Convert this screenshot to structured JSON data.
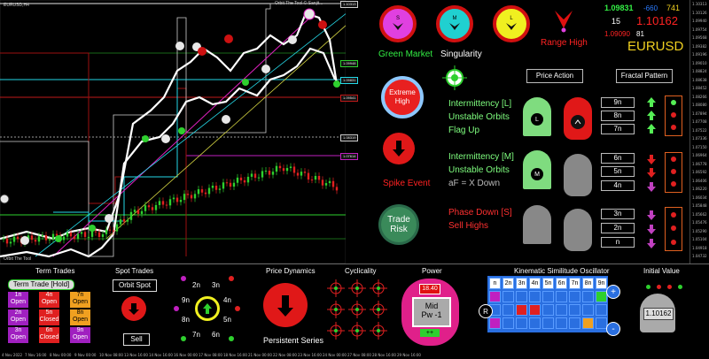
{
  "chart": {
    "symbol_header": "EURUSD,H4",
    "indicator_name": "Orbit The Tool",
    "footer_name": "Orbit The Tool © Sanjit...",
    "price_labels": [
      "1.10313",
      "1.10126",
      "1.09940",
      "1.09754",
      "1.09568",
      "1.09382",
      "1.09196",
      "1.09010",
      "1.08824",
      "1.08638",
      "1.08452",
      "1.08266",
      "1.08080",
      "1.07894",
      "1.07708",
      "1.07522",
      "1.07336",
      "1.07150",
      "1.06964",
      "1.06778",
      "1.06592",
      "1.06406",
      "1.06220",
      "1.06034",
      "1.05848",
      "1.05662",
      "1.05476",
      "1.05290",
      "1.05104",
      "1.04918",
      "1.04732",
      "1.04546"
    ],
    "level_badges": [
      "1.10313",
      "1.09948",
      "1.09831",
      "1.10162",
      "1.09541",
      "1.08319",
      "1.07614",
      "1.06520"
    ],
    "date_labels": [
      "4 Nov 2022",
      "7 Nov 16:00",
      "8 Nov 00:00",
      "9 Nov 00:00",
      "10 Nov 08:00",
      "13 Nov 16:00",
      "14 Nov 16:00",
      "16 Nov 00:00",
      "17 Nov 08:00",
      "18 Nov 16:00",
      "21 Nov 00:00",
      "22 Nov 08:00",
      "23 Nov 16:00",
      "24 Nov 00:00",
      "27 Nov 08:00",
      "28 Nov 16:00",
      "29 Nov 16:00"
    ]
  },
  "top_circles": [
    {
      "letter": "S",
      "color": "#e040e0"
    },
    {
      "letter": "M",
      "color": "#20d0d0"
    },
    {
      "letter": "L",
      "color": "#f0f020"
    }
  ],
  "range_high": "Range High",
  "price_box": {
    "bid": "1.09831",
    "change": "-660",
    "pips": "741",
    "spread": "15",
    "price": "1.10162",
    "low": "1.09090",
    "low_pips": "81",
    "symbol": "EURUSD"
  },
  "market_state": "Green Market",
  "singularity": "Singularity",
  "extreme_high": "Extreme High",
  "spike_event": "Spike Event",
  "trade_risk": "Trade Risk",
  "price_action_btn": "Price Action",
  "fractal_pattern_btn": "Fractal Pattern",
  "orbit_rows": [
    {
      "lines": [
        "Intermittency [L]",
        "Unstable Orbits",
        "Flag Up"
      ],
      "color": "#7fff7f",
      "badge": "L"
    },
    {
      "lines": [
        "Intermittency [M]",
        "Unstable Orbits",
        "aF = X Down"
      ],
      "color": "#7fff7f",
      "badge": "M"
    },
    {
      "lines": [
        "Phase Down [S]",
        "Sell Highs"
      ],
      "color": "#ff3030",
      "badge": ""
    }
  ],
  "fractal_cells": [
    "9n",
    "8n",
    "7n",
    "6n",
    "5n",
    "4n",
    "3n",
    "2n",
    "n"
  ],
  "bottom": {
    "term_trades": {
      "title": "Term Trades",
      "button": "Term Trade [Hold]",
      "cells": [
        {
          "label": "1n\nOpen"
        },
        {
          "label": "4n\nOpen"
        },
        {
          "label": "7n\nOpen"
        },
        {
          "label": "2n\nOpen"
        },
        {
          "label": "5n\nClosed"
        },
        {
          "label": "8n\nOpen"
        },
        {
          "label": "3n\nOpen"
        },
        {
          "label": "6n\nClosed"
        },
        {
          "label": "9n\nOpen"
        }
      ]
    },
    "spot_trades": {
      "title": "Spot Trades",
      "button": "Orbit Spot",
      "sell": "Sell"
    },
    "orbit_ring": {
      "labels": [
        "2n",
        "3n",
        "4n",
        "5n",
        "6n",
        "7n",
        "8n",
        "9n"
      ]
    },
    "price_dynamics": {
      "title": "Price Dynamics",
      "caption": "Persistent Series"
    },
    "cyclicality": {
      "title": "Cyclicality"
    },
    "power": {
      "title": "Power",
      "value": "18.40",
      "mid": "Mid",
      "pw": "Pw -1",
      "plus": "++"
    },
    "kso": {
      "title": "Kinematic Similitude Oscillator",
      "headers": [
        "n",
        "2n",
        "3n",
        "4n",
        "5n",
        "6n",
        "7n",
        "8n",
        "9n"
      ],
      "r_label": "R",
      "plus": "+",
      "minus": "-"
    },
    "initial_value": {
      "title": "Initial Value",
      "value": "1.10162"
    }
  }
}
